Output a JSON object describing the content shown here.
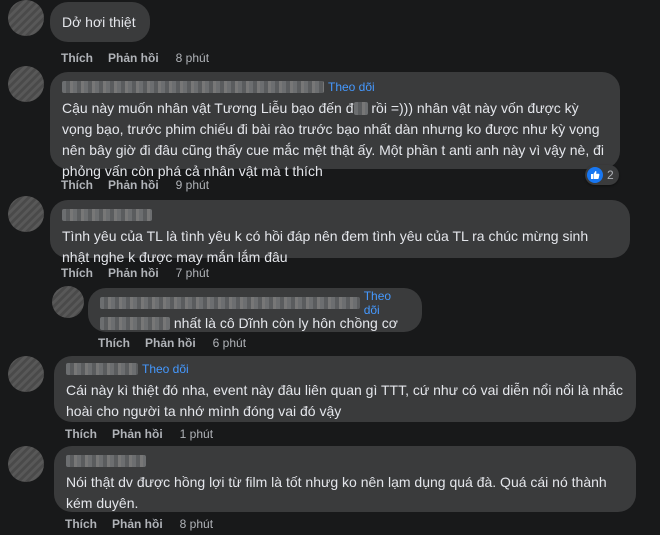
{
  "comments": [
    {
      "text": "Dở hơi thiệt",
      "actions": {
        "like": "Thích",
        "reply": "Phản hồi",
        "time": "8 phút"
      }
    },
    {
      "follow": "Theo dõi",
      "text_part1": "Cậu này muốn nhân vật Tương Liễu bạo đến đ",
      "text_part2": " rồi =))) nhân vật này vốn được kỳ vọng bạo, trước phim chiếu đi bài rào trước bạo nhất dàn nhưng ko được như kỳ vọng nên bây giờ đi đâu cũng thấy cue mắc mệt thật ấy. Một phần t anti anh này vì vậy nè, đi phỏng vấn còn phá cả nhân vật mà t thích",
      "reaction_count": "2",
      "actions": {
        "like": "Thích",
        "reply": "Phản hồi",
        "time": "9 phút"
      }
    },
    {
      "text": "Tình yêu của TL là tình yêu k có hồi đáp nên đem tình yêu của TL ra chúc mừng sinh nhật nghe k được may mắn lắm đâu",
      "actions": {
        "like": "Thích",
        "reply": "Phản hồi",
        "time": "7 phút"
      }
    },
    {
      "follow": "Theo dõi",
      "text": " nhất là cô Dĩnh còn ly hôn chồng cơ",
      "actions": {
        "like": "Thích",
        "reply": "Phản hồi",
        "time": "6 phút"
      }
    },
    {
      "follow": "Theo dõi",
      "text": "Cái này kì thiệt đó nha, event này đâu liên quan gì TTT, cứ như có vai diễn nổi nổi là nhắc hoài cho người ta nhớ mình đóng vai đó vậy",
      "actions": {
        "like": "Thích",
        "reply": "Phản hồi",
        "time": "1 phút"
      }
    },
    {
      "text": "Nói thật dv được hồng lợi từ film là tốt nhưg ko nên lạm dụng quá đà. Quá cái nó thành kém duyên.",
      "actions": {
        "like": "Thích",
        "reply": "Phản hồi",
        "time": "8 phút"
      }
    }
  ],
  "colors": {
    "background": "#18191a",
    "bubble": "#3a3b3c",
    "follow": "#4599ff",
    "like": "#1877f2"
  },
  "icons": {
    "reaction": "like-icon"
  }
}
